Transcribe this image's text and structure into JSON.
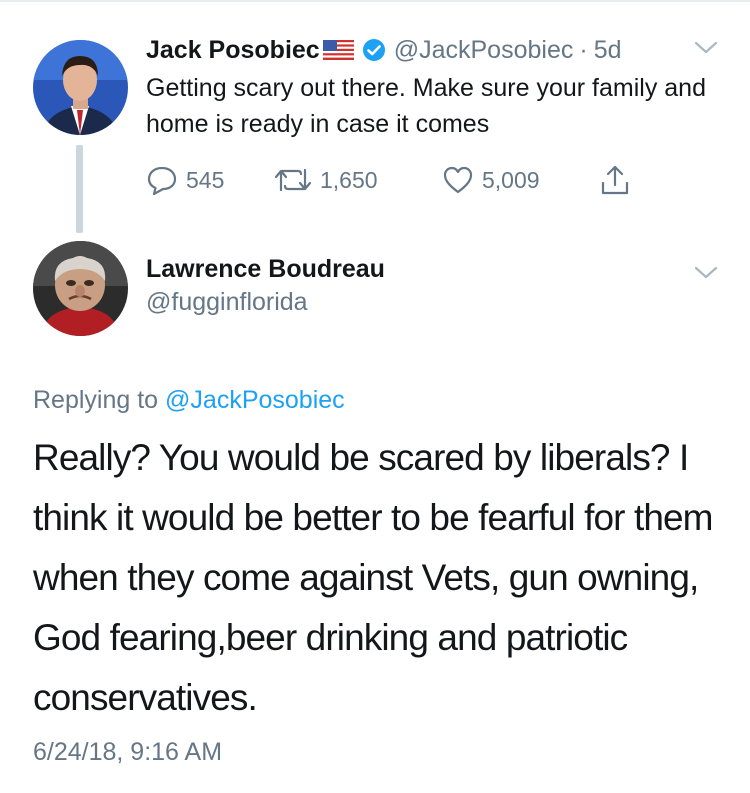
{
  "parent_tweet": {
    "author_name": "Jack Posobiec",
    "flag": "🇺🇸",
    "verified_icon": "verified-badge-icon",
    "handle": "@JackPosobiec",
    "separator": "·",
    "time": "5d",
    "text": "Getting scary out there. Make sure your family and home is ready in case it comes",
    "reply_count": "545",
    "retweet_count": "1,650",
    "like_count": "5,009"
  },
  "reply_tweet": {
    "author_name": "Lawrence Boudreau",
    "handle": "@fugginflorida",
    "replying_prefix": "Replying to",
    "replying_to": "@JackPosobiec",
    "text": "Really? You would be scared by liberals? I think it would be better to be fearful for them when they come against Vets, gun owning, God fearing,beer drinking and patriotic conservatives.",
    "timestamp": "6/24/18, 9:16 AM"
  },
  "colors": {
    "text": "#14171a",
    "secondary": "#657786",
    "link": "#1da1f2",
    "thread_line": "#ccd6dd"
  }
}
